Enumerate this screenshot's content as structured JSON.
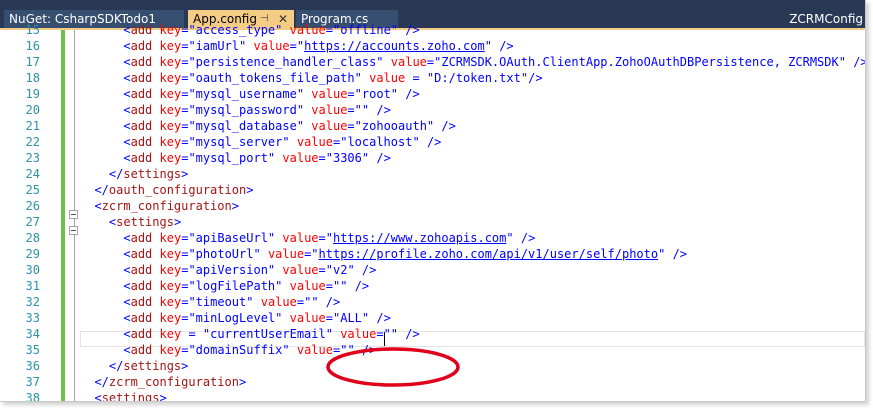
{
  "tabs": [
    {
      "label": "NuGet: CsharpSDKTodo1",
      "active": false
    },
    {
      "label": "App.config",
      "active": true,
      "pin_icon": "pin-icon",
      "close_icon": "close-icon"
    },
    {
      "label": "Program.cs",
      "active": false
    }
  ],
  "tab_right_label": "ZCRMConfig",
  "colors": {
    "tab_strip": "#293955",
    "active_tab": "#f5cc84",
    "change_bar": "#6cc24a",
    "highlight": "#e0001b"
  },
  "lines": [
    {
      "n": "15",
      "text": "      <add key=\"access_type\" value=\"offline\" />"
    },
    {
      "n": "16",
      "text": "      <add key=\"iamUrl\" value=\"https://accounts.zoho.com\" />"
    },
    {
      "n": "17",
      "text": "      <add key=\"persistence_handler_class\" value=\"ZCRMSDK.OAuth.ClientApp.ZohoOAuthDBPersistence, ZCRMSDK\" />"
    },
    {
      "n": "18",
      "text": "      <add key=\"oauth_tokens_file_path\" value = \"D:/token.txt\"/>"
    },
    {
      "n": "19",
      "text": "      <add key=\"mysql_username\" value=\"root\" />"
    },
    {
      "n": "20",
      "text": "      <add key=\"mysql_password\" value=\"\" />"
    },
    {
      "n": "21",
      "text": "      <add key=\"mysql_database\" value=\"zohooauth\" />"
    },
    {
      "n": "22",
      "text": "      <add key=\"mysql_server\" value=\"localhost\" />"
    },
    {
      "n": "23",
      "text": "      <add key=\"mysql_port\" value=\"3306\" />"
    },
    {
      "n": "24",
      "text": "    </settings>"
    },
    {
      "n": "25",
      "text": "  </oauth_configuration>"
    },
    {
      "n": "26",
      "text": "  <zcrm_configuration>"
    },
    {
      "n": "27",
      "text": "    <settings>"
    },
    {
      "n": "28",
      "text": "      <add key=\"apiBaseUrl\" value=\"https://www.zohoapis.com\" />"
    },
    {
      "n": "29",
      "text": "      <add key=\"photoUrl\" value=\"https://profile.zoho.com/api/v1/user/self/photo\" />"
    },
    {
      "n": "30",
      "text": "      <add key=\"apiVersion\" value=\"v2\" />"
    },
    {
      "n": "31",
      "text": "      <add key=\"logFilePath\" value=\"\" />"
    },
    {
      "n": "32",
      "text": "      <add key=\"timeout\" value=\"\" />"
    },
    {
      "n": "33",
      "text": "      <add key=\"minLogLevel\" value=\"ALL\" />"
    },
    {
      "n": "34",
      "text": "      <add key = \"currentUserEmail\" value=\"\" />"
    },
    {
      "n": "35",
      "text": "      <add key=\"domainSuffix\" value=\"\" />"
    },
    {
      "n": "36",
      "text": "    </settings>"
    },
    {
      "n": "37",
      "text": "  </zcrm_configuration>"
    },
    {
      "n": "38",
      "text": "  <settings>"
    }
  ]
}
